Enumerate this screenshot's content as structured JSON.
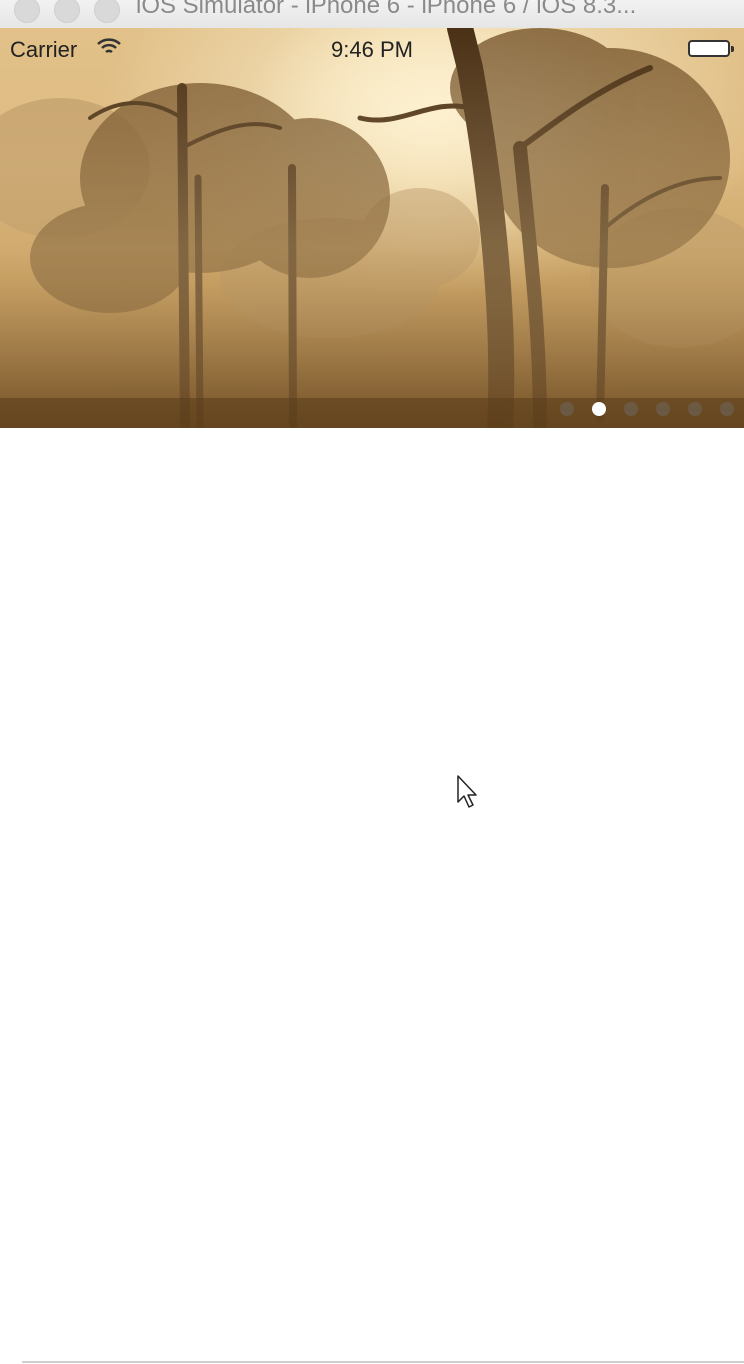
{
  "window": {
    "title": "iOS Simulator - iPhone 6 - iPhone 6 / iOS 8.3..."
  },
  "status_bar": {
    "carrier": "Carrier",
    "time": "9:46 PM",
    "wifi_icon": "wifi-icon",
    "battery_icon": "battery-icon"
  },
  "banner": {
    "image": "misty-forest-photo",
    "page_count": 6,
    "current_page": 2
  },
  "colors": {
    "page_dot_active": "#ffffff",
    "page_dot_inactive": "#6e5f50",
    "background": "#ffffff"
  }
}
